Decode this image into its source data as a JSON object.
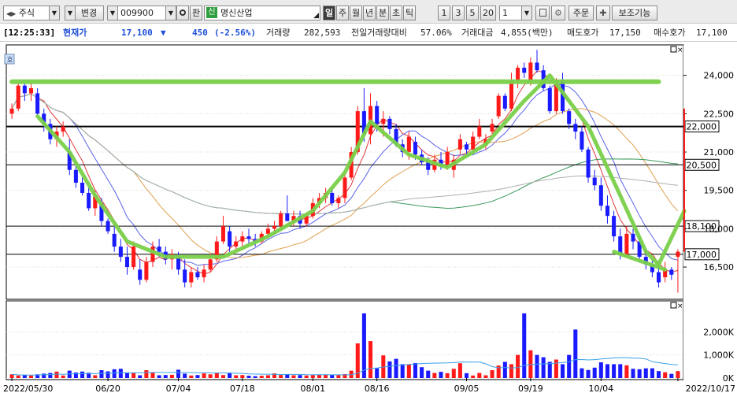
{
  "toolbar": {
    "market": "주식",
    "change_label": "변경",
    "code": "009900",
    "pan_label": "판",
    "credit_badge": "신",
    "stock_name": "명신산업",
    "periods": [
      "일",
      "주",
      "월",
      "년",
      "분",
      "초",
      "틱"
    ],
    "intervals": [
      "1",
      "3",
      "5",
      "20"
    ],
    "count": "1",
    "order_label": "주문",
    "aux_label": "보조기능"
  },
  "info": {
    "time": "[12:25:33]",
    "price_label": "현재가",
    "price": "17,100",
    "change": "450",
    "change_pct": "(-2.56%)",
    "volume_label": "거래량",
    "volume": "282,593",
    "prev_vol_label": "전일거래량대비",
    "prev_vol_pct": "57.06%",
    "amount_label": "거래대금",
    "amount": "4,855(백만)",
    "ask_label": "매도호가",
    "ask": "17,150",
    "bid_label": "매수호가",
    "bid": "17,100"
  },
  "chart_data": {
    "type": "candlestick",
    "price_axis": {
      "ticks": [
        "24,000",
        "22,500",
        "21,000",
        "19,500",
        "18,000",
        "16,500"
      ],
      "ymin": 15300,
      "ymax": 25100
    },
    "volume_axis": {
      "ticks": [
        "2,000K",
        "1,000K",
        "0K"
      ],
      "ymax": 3000
    },
    "date_labels": [
      "2022/05/30",
      "06/20",
      "07/04",
      "07/18",
      "08/01",
      "08/16",
      "09/05",
      "09/19",
      "10/04",
      "2022/10/17"
    ],
    "hlines": [
      {
        "value": 22000,
        "label": "22,000"
      },
      {
        "value": 20500,
        "label": "20,500"
      },
      {
        "value": 18100,
        "label": "18,100"
      },
      {
        "value": 17000,
        "label": "17,000"
      }
    ],
    "candles": [
      [
        22500,
        22900,
        22300,
        22700
      ],
      [
        22700,
        23700,
        22600,
        23600
      ],
      [
        23600,
        23700,
        23000,
        23300
      ],
      [
        23300,
        23700,
        23000,
        23500
      ],
      [
        23300,
        23500,
        22400,
        22500
      ],
      [
        22500,
        22700,
        21800,
        22100
      ],
      [
        22100,
        22300,
        21300,
        21500
      ],
      [
        21500,
        22000,
        21200,
        21800
      ],
      [
        21800,
        22200,
        21600,
        22000
      ],
      [
        21000,
        21500,
        20100,
        20300
      ],
      [
        20300,
        20600,
        19600,
        19800
      ],
      [
        19800,
        20000,
        19300,
        19400
      ],
      [
        19400,
        19600,
        18700,
        18800
      ],
      [
        18800,
        19500,
        18500,
        19300
      ],
      [
        19000,
        19200,
        18100,
        18300
      ],
      [
        18300,
        18400,
        17800,
        17900
      ],
      [
        17800,
        18200,
        17100,
        17300
      ],
      [
        17300,
        17600,
        16700,
        16900
      ],
      [
        16900,
        17300,
        16200,
        16500
      ],
      [
        16500,
        17500,
        16400,
        17300
      ],
      [
        16400,
        16800,
        15800,
        16000
      ],
      [
        16000,
        16900,
        15900,
        16700
      ],
      [
        16700,
        17500,
        16500,
        17300
      ],
      [
        17300,
        17600,
        16900,
        17100
      ],
      [
        17100,
        17300,
        16600,
        16800
      ],
      [
        16800,
        17200,
        16400,
        17000
      ],
      [
        16900,
        17100,
        16200,
        16400
      ],
      [
        16400,
        16800,
        15700,
        15900
      ],
      [
        15900,
        16500,
        15700,
        16300
      ],
      [
        16300,
        16500,
        16000,
        16100
      ],
      [
        16100,
        16600,
        15900,
        16400
      ],
      [
        16400,
        17000,
        16300,
        16800
      ],
      [
        16800,
        17700,
        16700,
        17500
      ],
      [
        17500,
        18500,
        17400,
        18100
      ],
      [
        17900,
        18100,
        17100,
        17300
      ],
      [
        17300,
        17700,
        17100,
        17500
      ],
      [
        17500,
        17900,
        17300,
        17700
      ],
      [
        17700,
        18000,
        17400,
        17600
      ],
      [
        17600,
        17800,
        17300,
        17500
      ],
      [
        17500,
        17900,
        17400,
        17800
      ],
      [
        17800,
        18200,
        17700,
        18000
      ],
      [
        18000,
        18300,
        17800,
        18100
      ],
      [
        18100,
        18700,
        18000,
        18600
      ],
      [
        18600,
        19300,
        18300,
        18300
      ],
      [
        18300,
        18700,
        18100,
        18500
      ],
      [
        18500,
        18700,
        18000,
        18200
      ],
      [
        18200,
        18600,
        18100,
        18500
      ],
      [
        18500,
        19200,
        18400,
        19000
      ],
      [
        19000,
        19400,
        18800,
        19200
      ],
      [
        19200,
        19600,
        19000,
        19400
      ],
      [
        19400,
        19600,
        18900,
        19000
      ],
      [
        19000,
        19300,
        18800,
        19200
      ],
      [
        19200,
        20200,
        19000,
        20000
      ],
      [
        20000,
        21200,
        19900,
        21000
      ],
      [
        21000,
        22800,
        20900,
        22600
      ],
      [
        22600,
        23500,
        21400,
        21700
      ],
      [
        21700,
        23300,
        21300,
        22800
      ],
      [
        22800,
        23000,
        21800,
        22100
      ],
      [
        22100,
        22600,
        21600,
        22300
      ],
      [
        22300,
        22400,
        21700,
        21900
      ],
      [
        21900,
        22100,
        21200,
        21300
      ],
      [
        21300,
        21500,
        20800,
        21000
      ],
      [
        21000,
        21800,
        20700,
        21600
      ],
      [
        21400,
        21600,
        20700,
        20900
      ],
      [
        20900,
        21100,
        20500,
        20600
      ],
      [
        20600,
        20800,
        20100,
        20300
      ],
      [
        20300,
        20900,
        20200,
        20700
      ],
      [
        20700,
        21000,
        20300,
        20500
      ],
      [
        20500,
        21200,
        20300,
        21000
      ],
      [
        20300,
        20900,
        20000,
        20700
      ],
      [
        21100,
        21700,
        20900,
        21500
      ],
      [
        21300,
        21400,
        20900,
        21100
      ],
      [
        21100,
        21800,
        21000,
        21600
      ],
      [
        21600,
        22300,
        21500,
        22000
      ],
      [
        21300,
        21700,
        21100,
        21500
      ],
      [
        21800,
        22300,
        21700,
        22100
      ],
      [
        22400,
        23300,
        22300,
        23200
      ],
      [
        23200,
        23300,
        22600,
        22700
      ],
      [
        22700,
        24100,
        22600,
        23800
      ],
      [
        23800,
        24400,
        23500,
        24300
      ],
      [
        24300,
        24500,
        23900,
        24100
      ],
      [
        23800,
        24700,
        23600,
        24500
      ],
      [
        24500,
        25000,
        24100,
        24200
      ],
      [
        24200,
        24400,
        23400,
        23500
      ],
      [
        23500,
        23600,
        22500,
        22600
      ],
      [
        22600,
        23900,
        22500,
        23800
      ],
      [
        23800,
        24100,
        22500,
        22600
      ],
      [
        22600,
        22700,
        21900,
        22100
      ],
      [
        22100,
        22300,
        21500,
        21800
      ],
      [
        21800,
        22000,
        21000,
        21100
      ],
      [
        21100,
        21200,
        19800,
        20000
      ],
      [
        20000,
        20300,
        19500,
        19700
      ],
      [
        19700,
        20000,
        18700,
        18900
      ],
      [
        18900,
        19300,
        18200,
        18500
      ],
      [
        18500,
        18700,
        17500,
        17700
      ],
      [
        17700,
        18000,
        16800,
        17000
      ],
      [
        17000,
        18100,
        16900,
        17800
      ],
      [
        17800,
        18000,
        17200,
        17500
      ],
      [
        17500,
        17700,
        16700,
        16900
      ],
      [
        16900,
        17200,
        16400,
        16600
      ],
      [
        16600,
        16800,
        16100,
        16300
      ],
      [
        16300,
        16600,
        15700,
        15900
      ],
      [
        16100,
        16700,
        15900,
        16400
      ],
      [
        16400,
        16500,
        16000,
        16200
      ],
      [
        16900,
        17200,
        15500,
        17100
      ]
    ],
    "volume": [
      160,
      110,
      130,
      110,
      160,
      190,
      220,
      280,
      110,
      320,
      240,
      280,
      230,
      120,
      340,
      290,
      380,
      400,
      230,
      230,
      120,
      340,
      230,
      120,
      130,
      140,
      360,
      190,
      110,
      130,
      200,
      160,
      210,
      130,
      230,
      120,
      130,
      100,
      80,
      100,
      120,
      200,
      130,
      170,
      120,
      130,
      110,
      130,
      150,
      140,
      140,
      130,
      170,
      320,
      1500,
      2800,
      1600,
      420,
      980,
      720,
      830,
      600,
      580,
      650,
      470,
      320,
      220,
      270,
      210,
      400,
      640,
      210,
      110,
      220,
      120,
      340,
      540,
      700,
      600,
      1000,
      2800,
      1200,
      1000,
      900,
      700,
      800,
      600,
      1000,
      2100,
      420,
      350,
      450,
      680,
      600,
      600,
      600,
      550,
      400,
      380,
      420,
      420,
      300,
      250,
      180,
      300
    ]
  }
}
